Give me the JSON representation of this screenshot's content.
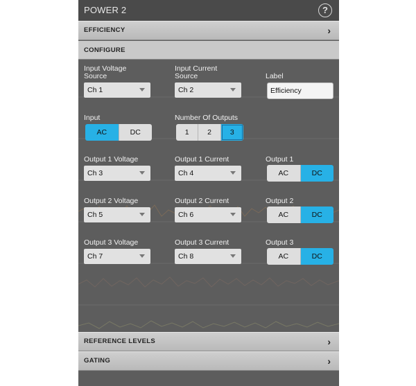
{
  "panel": {
    "title": "POWER 2",
    "help_icon": "?",
    "sections": {
      "efficiency": "EFFICIENCY",
      "configure": "CONFIGURE",
      "reference_levels": "REFERENCE LEVELS",
      "gating": "GATING"
    }
  },
  "configure": {
    "input_voltage_source": {
      "label_line1": "Input Voltage",
      "label_line2": "Source",
      "value": "Ch 1"
    },
    "input_current_source": {
      "label_line1": "Input Current",
      "label_line2": "Source",
      "value": "Ch 2"
    },
    "label": {
      "label": "Label",
      "value": "Efficiency"
    },
    "input": {
      "label": "Input",
      "options": [
        "AC",
        "DC"
      ],
      "selected": "AC"
    },
    "number_of_outputs": {
      "label": "Number Of Outputs",
      "options": [
        "1",
        "2",
        "3"
      ],
      "selected": "3"
    },
    "outputs": [
      {
        "voltage_label": "Output 1 Voltage",
        "voltage_value": "Ch 3",
        "current_label": "Output 1 Current",
        "current_value": "Ch 4",
        "coupling_label": "Output 1",
        "options": [
          "AC",
          "DC"
        ],
        "selected": "DC"
      },
      {
        "voltage_label": "Output 2 Voltage",
        "voltage_value": "Ch 5",
        "current_label": "Output 2 Current",
        "current_value": "Ch 6",
        "coupling_label": "Output 2",
        "options": [
          "AC",
          "DC"
        ],
        "selected": "DC"
      },
      {
        "voltage_label": "Output 3 Voltage",
        "voltage_value": "Ch 7",
        "current_label": "Output 3 Current",
        "current_value": "Ch 8",
        "coupling_label": "Output 3",
        "options": [
          "AC",
          "DC"
        ],
        "selected": "DC"
      }
    ]
  },
  "colors": {
    "selected": "#27b1e6",
    "panel_bg": "#5d5d5d",
    "header_bg": "#4a4a4a"
  }
}
